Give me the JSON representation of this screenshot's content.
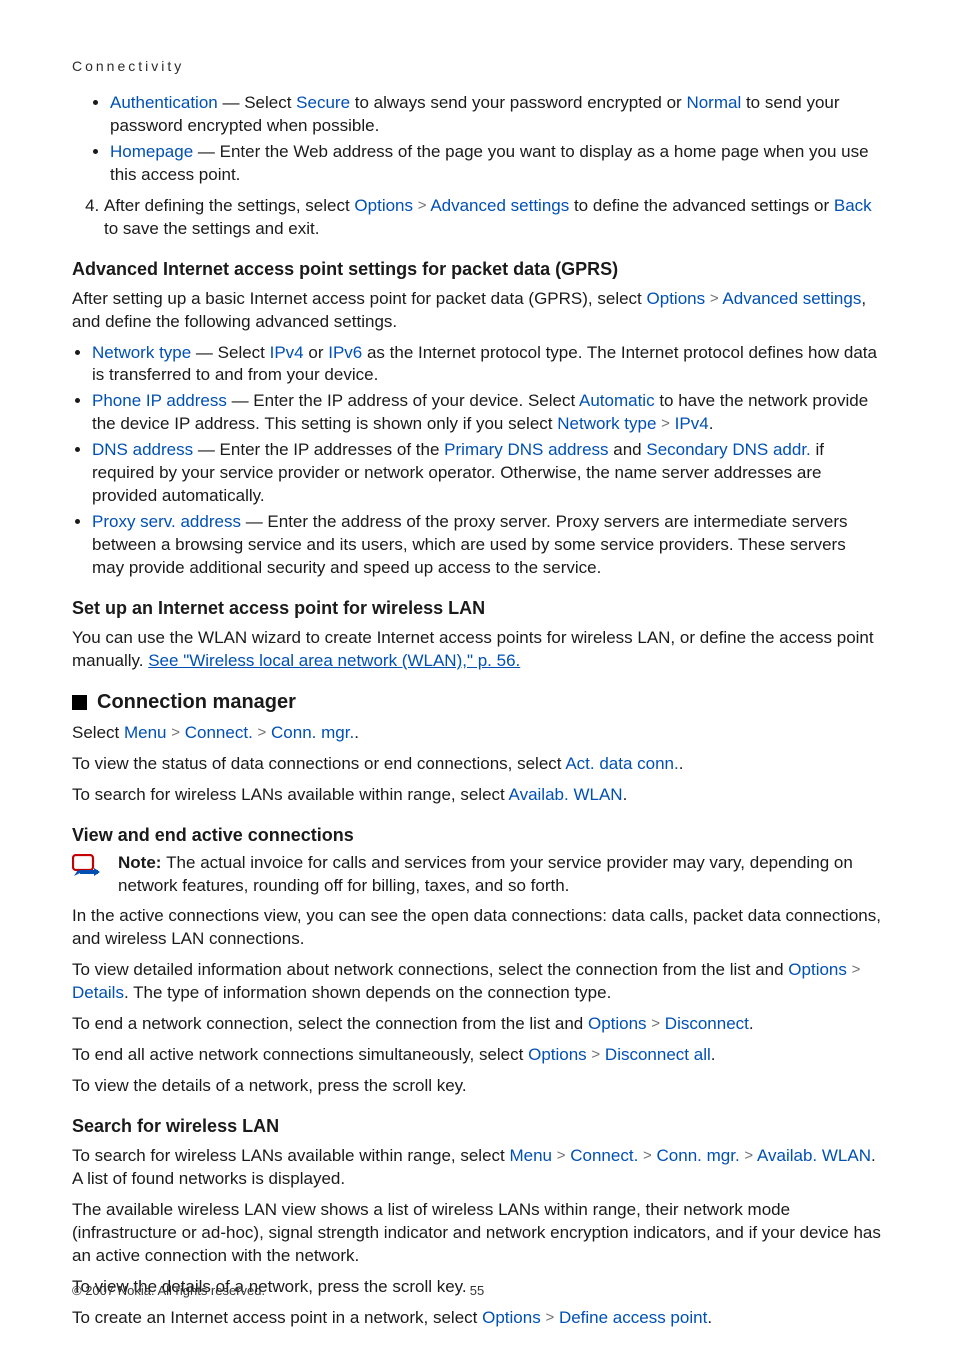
{
  "breadcrumb": "Connectivity",
  "bullets1": [
    {
      "label": "Authentication",
      "rest": " — Select ",
      "opt1": "Secure",
      "mid": " to always send your password encrypted or ",
      "opt2": "Normal",
      "end": " to send your password encrypted when possible."
    },
    {
      "label": "Homepage",
      "rest": " — Enter the Web address of the page you want to display as a home page when you use this access point."
    }
  ],
  "step4": {
    "pre": "After defining the settings, select ",
    "o": "Options",
    "as": "Advanced settings",
    "mid": " to define the advanced settings or ",
    "b": "Back",
    "end": " to save the settings and exit."
  },
  "gprsHeading": "Advanced Internet access point settings for packet data (GPRS)",
  "gprsIntro": {
    "pre": "After setting up a basic Internet access point for packet data (GPRS), select ",
    "o": "Options",
    "as": "Advanced settings",
    "end": ", and define the following advanced settings."
  },
  "gprsBullets": [
    {
      "label": "Network type",
      "rest": " — Select ",
      "a": "IPv4",
      "or": " or ",
      "b": "IPv6",
      "end": " as the Internet protocol type. The Internet protocol defines how data is transferred to and from your device."
    },
    {
      "label": "Phone IP address",
      "rest": " — Enter the IP address of your device. Select ",
      "a": "Automatic",
      "end1": " to have the network provide the device IP address. This setting is shown only if you select ",
      "nt": "Network type",
      "ip": "IPv4",
      "dot": "."
    },
    {
      "label": "DNS address",
      "rest": " — Enter the IP addresses of the ",
      "p": "Primary DNS address",
      "and": " and ",
      "s": "Secondary DNS addr.",
      "end": " if required by your service provider or network operator. Otherwise, the name server addresses are provided automatically."
    },
    {
      "label": "Proxy serv. address",
      "rest": " — Enter the address of the proxy server. Proxy servers are intermediate servers between a browsing service and its users, which are used by some service providers. These servers may provide additional security and speed up access to the service."
    }
  ],
  "wlanHeading": "Set up an Internet access point for wireless LAN",
  "wlanText": {
    "pre": "You can use the WLAN wizard to create Internet access points for wireless LAN, or define the access point manually. ",
    "link": "See \"Wireless local area network (WLAN),\" p. 56."
  },
  "connMgrHeading": "Connection manager",
  "cmSelect": {
    "pre": "Select ",
    "m": "Menu",
    "c": "Connect.",
    "g": "Conn. mgr.",
    "end": "."
  },
  "cmStatus": {
    "pre": "To view the status of data connections or end connections, select ",
    "a": "Act. data conn.",
    "end": "."
  },
  "cmSearch": {
    "pre": "To search for wireless LANs available within range, select ",
    "a": "Availab. WLAN",
    "end": "."
  },
  "vaeHeading": "View and end active connections",
  "note": {
    "bold": "Note:  ",
    "txt": "The actual invoice for calls and services from your service provider may vary, depending on network features, rounding off for billing, taxes, and so forth."
  },
  "vae1": "In the active connections view, you can see the open data connections: data calls, packet data connections, and wireless LAN connections.",
  "vae2": {
    "pre": "To view detailed information about network connections, select the connection from the list and ",
    "o": "Options",
    "d": "Details",
    "end": ". The type of information shown depends on the connection type."
  },
  "vae3": {
    "pre": "To end a network connection, select the connection from the list and ",
    "o": "Options",
    "d": "Disconnect",
    "end": "."
  },
  "vae4": {
    "pre": "To end all active network connections simultaneously, select ",
    "o": "Options",
    "d": "Disconnect all",
    "end": "."
  },
  "vae5": "To view the details of a network, press the scroll key.",
  "swHeading": "Search for wireless LAN",
  "sw1": {
    "pre": "To search for wireless LANs available within range, select ",
    "m": "Menu",
    "c": "Connect.",
    "g": "Conn. mgr.",
    "a": "Availab. WLAN",
    "end": ". A list of found networks is displayed."
  },
  "sw2": "The available wireless LAN view shows a list of wireless LANs within range, their network mode (infrastructure or ad-hoc), signal strength indicator and network encryption indicators, and if your device has an active connection with the network.",
  "sw3": "To view the details of a network, press the scroll key.",
  "sw4": {
    "pre": "To create an Internet access point in a network, select ",
    "o": "Options",
    "d": "Define access point",
    "end": "."
  },
  "copyright": "© 2007 Nokia. All rights reserved.",
  "pageNum": "55",
  "gtSym": ">"
}
